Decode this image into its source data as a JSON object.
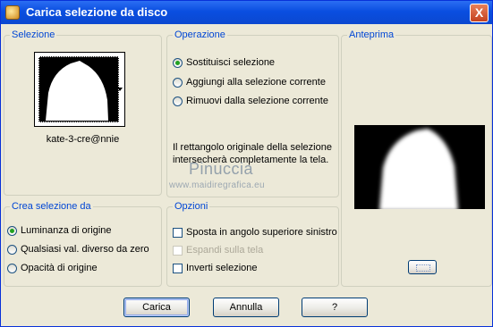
{
  "window": {
    "title": "Carica selezione da disco",
    "close_label": "X"
  },
  "selezione": {
    "title": "Selezione",
    "thumbnail_name": "kate-3-cre@nnie"
  },
  "operazione": {
    "title": "Operazione",
    "options": [
      {
        "label": "Sostituisci selezione",
        "selected": true
      },
      {
        "label": "Aggiungi alla selezione corrente",
        "selected": false
      },
      {
        "label": "Rimuovi dalla selezione corrente",
        "selected": false
      }
    ],
    "info": "Il rettangolo originale della selezione intersecherà completamente la tela."
  },
  "anteprima": {
    "title": "Anteprima"
  },
  "crea": {
    "title": "Crea selezione da",
    "options": [
      {
        "label": "Luminanza di origine",
        "selected": true
      },
      {
        "label": "Qualsiasi val. diverso da zero",
        "selected": false
      },
      {
        "label": "Opacità di origine",
        "selected": false
      }
    ]
  },
  "opzioni": {
    "title": "Opzioni",
    "items": [
      {
        "label": "Sposta in angolo superiore sinistro",
        "checked": false,
        "enabled": true
      },
      {
        "label": "Espandi sulla tela",
        "checked": false,
        "enabled": false
      },
      {
        "label": "Inverti selezione",
        "checked": false,
        "enabled": true
      }
    ]
  },
  "watermark": {
    "name": "Pinuccia",
    "url": "www.maidiregrafica.eu"
  },
  "buttons": {
    "load": "Carica",
    "cancel": "Annulla",
    "help": "?"
  },
  "colors": {
    "title_bar": "#0a4ee0",
    "group_title": "#0046d5",
    "dialog_bg": "#ece9d8",
    "radio_selected": "#21a121"
  },
  "icons": {
    "app": "app-icon",
    "close": "close-icon",
    "dropdown": "dropdown-arrow-icon",
    "preview_button": "preview-toggle-icon"
  }
}
